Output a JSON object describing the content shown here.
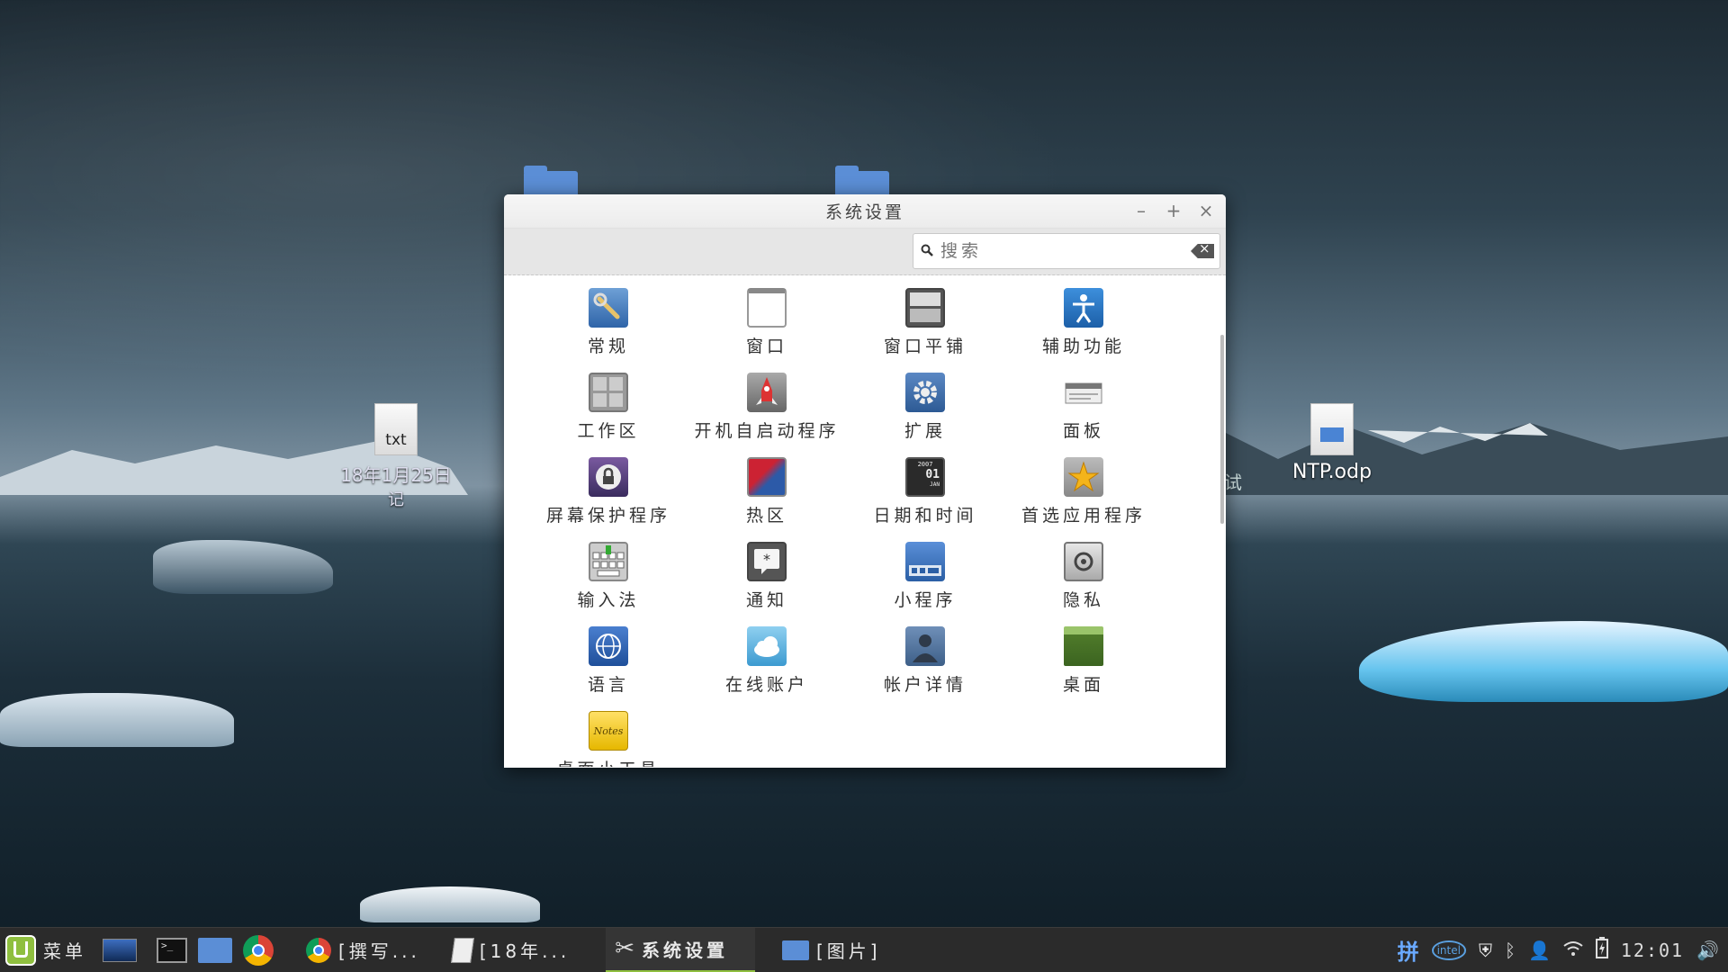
{
  "desktop": {
    "icons": [
      {
        "badge": "txt",
        "label_line1": "18年1月25日",
        "label_line2": "记"
      },
      {
        "label": "NTP.odp"
      }
    ],
    "partial_label": "试"
  },
  "window": {
    "title": "系统设置",
    "controls": {
      "minimize": "–",
      "maximize": "+",
      "close": "×"
    },
    "search": {
      "placeholder": "搜索"
    },
    "items": [
      {
        "label": "常规",
        "icon": "wrench-icon"
      },
      {
        "label": "窗口",
        "icon": "window-icon"
      },
      {
        "label": "窗口平铺",
        "icon": "tiling-icon"
      },
      {
        "label": "辅助功能",
        "icon": "accessibility-icon"
      },
      {
        "label": "工作区",
        "icon": "workspace-icon"
      },
      {
        "label": "开机自启动程序",
        "icon": "rocket-icon"
      },
      {
        "label": "扩展",
        "icon": "gear-icon"
      },
      {
        "label": "面板",
        "icon": "panel-icon"
      },
      {
        "label": "屏幕保护程序",
        "icon": "lock-icon"
      },
      {
        "label": "热区",
        "icon": "hotcorner-icon"
      },
      {
        "label": "日期和时间",
        "icon": "calendar-icon"
      },
      {
        "label": "首选应用程序",
        "icon": "star-icon"
      },
      {
        "label": "输入法",
        "icon": "keyboard-icon"
      },
      {
        "label": "通知",
        "icon": "notification-icon"
      },
      {
        "label": "小程序",
        "icon": "applet-icon"
      },
      {
        "label": "隐私",
        "icon": "privacy-icon"
      },
      {
        "label": "语言",
        "icon": "globe-icon"
      },
      {
        "label": "在线账户",
        "icon": "cloud-icon"
      },
      {
        "label": "帐户详情",
        "icon": "user-icon"
      },
      {
        "label": "桌面",
        "icon": "desktop-icon"
      },
      {
        "label": "桌面小工具",
        "icon": "notes-icon"
      }
    ],
    "calendar_badge": {
      "year": "2007",
      "day": "01",
      "month": "JAN"
    },
    "notes_badge": "Notes"
  },
  "taskbar": {
    "menu_label": "菜单",
    "tasks": [
      {
        "label": "[撰写..."
      },
      {
        "label": "[18年..."
      },
      {
        "label": "系统设置"
      },
      {
        "label": "[图片]"
      }
    ],
    "tray": {
      "ime": "拼",
      "intel": "intel",
      "clock": "12:01"
    }
  },
  "colors": {
    "accent": "#8fbf3f",
    "taskbar_bg": "#2b2b2b",
    "folder": "#5b8ed6"
  }
}
